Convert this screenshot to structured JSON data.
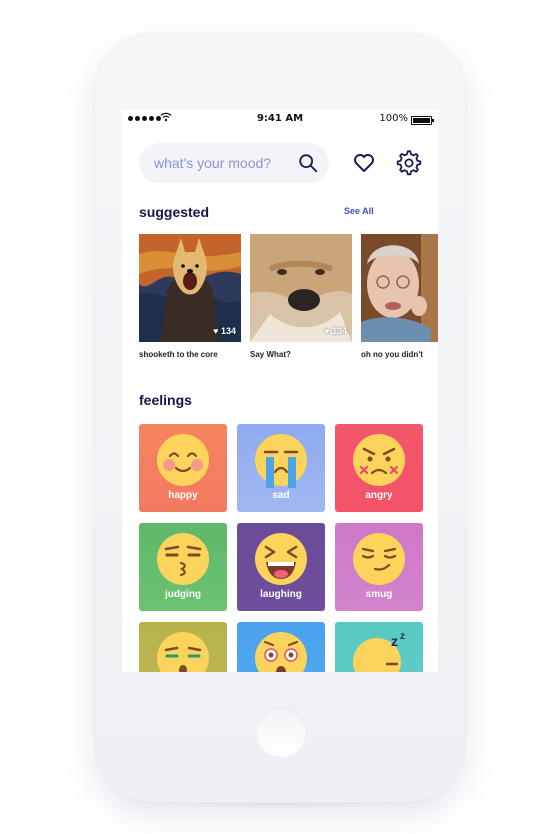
{
  "status_bar": {
    "time": "9:41 AM",
    "battery": "100%"
  },
  "search": {
    "placeholder": "what's your mood?"
  },
  "suggested": {
    "title": "suggested",
    "see_all": "See All",
    "items": [
      {
        "caption": "shooketh to the core",
        "likes": "134"
      },
      {
        "caption": "Say What?",
        "likes": "134"
      },
      {
        "caption": "oh no you didn't"
      }
    ]
  },
  "feelings": {
    "title": "feelings",
    "tiles": [
      {
        "label": "happy",
        "color": "#f5845e"
      },
      {
        "label": "sad",
        "color": "#8eaaf0"
      },
      {
        "label": "angry",
        "color": "#f4566c"
      },
      {
        "label": "judging",
        "color": "#5fb86b"
      },
      {
        "label": "laughing",
        "color": "#6a4b98"
      },
      {
        "label": "smug",
        "color": "#cf78c8"
      },
      {
        "label": "",
        "color": "#b8b34c"
      },
      {
        "label": "",
        "color": "#4aa2ef"
      },
      {
        "label": "",
        "color": "#58c9c1"
      }
    ]
  }
}
